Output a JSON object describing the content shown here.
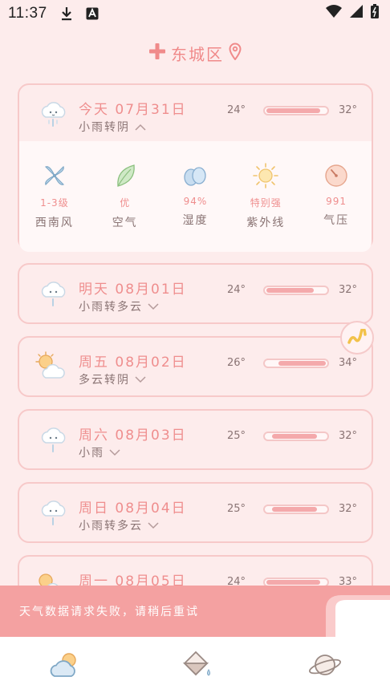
{
  "status_bar": {
    "time": "11:37",
    "icons": [
      "download-icon",
      "a-badge-icon",
      "wifi-icon",
      "signal-icon",
      "battery-icon"
    ]
  },
  "location": {
    "name": "东城区",
    "icons": [
      "add-icon",
      "location-pin-icon"
    ]
  },
  "today": {
    "title": "今天 07月31日",
    "desc": "小雨转阴",
    "tmin": "24°",
    "tmax": "32°",
    "range_fraction": [
      0.0,
      0.9
    ],
    "icon": "light-rain-icon",
    "details": [
      {
        "value": "1-3级",
        "label": "西南风",
        "icon": "windmill-icon"
      },
      {
        "value": "优",
        "label": "空气",
        "icon": "leaf-icon"
      },
      {
        "value": "94%",
        "label": "湿度",
        "icon": "droplets-icon"
      },
      {
        "value": "特别强",
        "label": "紫外线",
        "icon": "sun-icon"
      },
      {
        "value": "991",
        "label": "气压",
        "icon": "gauge-icon"
      }
    ]
  },
  "forecast": [
    {
      "title": "明天 08月01日",
      "desc": "小雨转多云",
      "tmin": "24°",
      "tmax": "32°",
      "range_fraction": [
        0.0,
        0.8
      ],
      "icon": "light-rain-icon"
    },
    {
      "title": "周五 08月02日",
      "desc": "多云转阴",
      "tmin": "26°",
      "tmax": "34°",
      "range_fraction": [
        0.2,
        1.0
      ],
      "icon": "sun-cloud-icon"
    },
    {
      "title": "周六 08月03日",
      "desc": "小雨",
      "tmin": "25°",
      "tmax": "32°",
      "range_fraction": [
        0.1,
        0.85
      ],
      "icon": "light-rain-icon"
    },
    {
      "title": "周日 08月04日",
      "desc": "小雨转多云",
      "tmin": "25°",
      "tmax": "32°",
      "range_fraction": [
        0.1,
        0.85
      ],
      "icon": "light-rain-icon"
    },
    {
      "title": "周一 08月05日",
      "desc": "",
      "tmin": "24°",
      "tmax": "33°",
      "range_fraction": [
        0.0,
        0.9
      ],
      "icon": "sun-cloud-icon"
    }
  ],
  "toast": {
    "message": "天气数据请求失败，请稍后重试"
  },
  "tabs": [
    {
      "name": "weather",
      "icon": "cloud-sun-icon"
    },
    {
      "name": "almanac",
      "icon": "paint-bucket-icon"
    },
    {
      "name": "planet",
      "icon": "planet-icon"
    }
  ],
  "colors": {
    "background": "#fdecec",
    "accent": "#ef8e8e",
    "toast": "#f4a1a1",
    "bar_fill": "#f4a9ab"
  }
}
